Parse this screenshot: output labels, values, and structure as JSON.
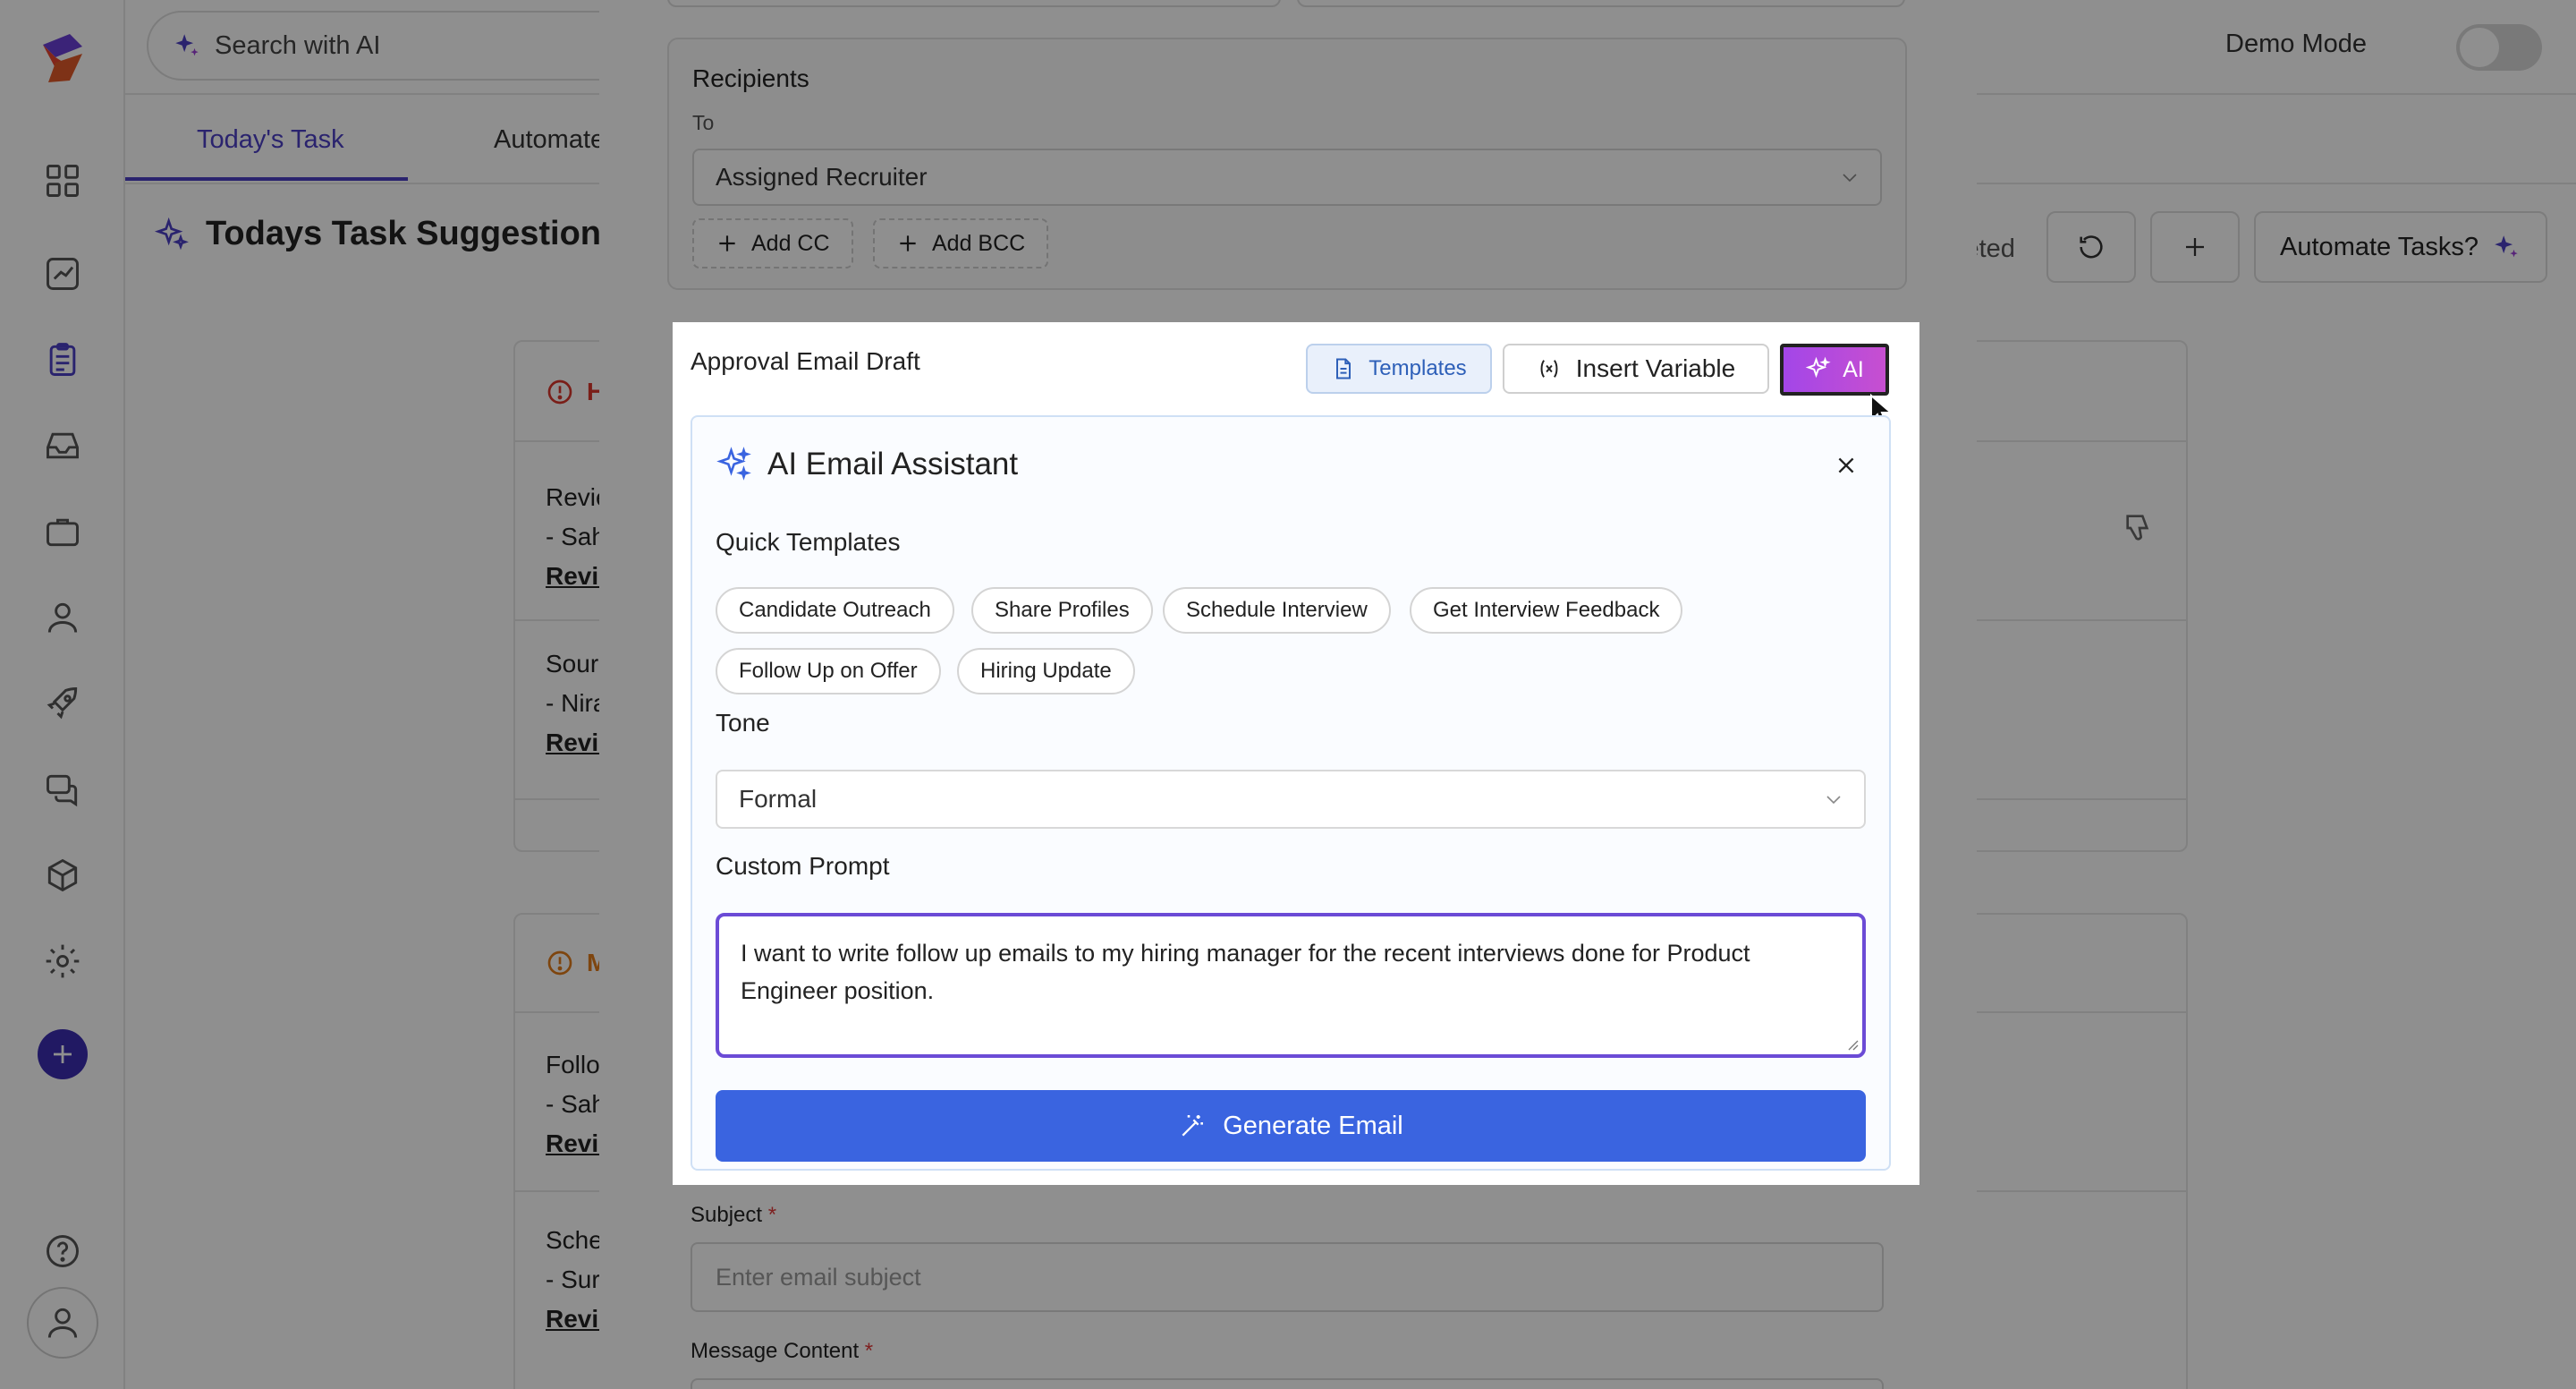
{
  "topbar": {
    "search_placeholder": "Search with AI",
    "demo_mode_label": "Demo Mode"
  },
  "tabs": [
    {
      "label": "Today's Task",
      "active": true
    },
    {
      "label": "Automate",
      "active": false
    }
  ],
  "page": {
    "title": "Todays Task Suggestions",
    "completed_label": "leted",
    "automate_button": "Automate Tasks?"
  },
  "cards": [
    {
      "badge": "H",
      "rows": [
        {
          "line1": "Revie",
          "line2": "- Sah",
          "link": "Revie"
        },
        {
          "line1": "Sourc",
          "line2": "- Nira",
          "link": "Revie"
        }
      ]
    },
    {
      "badge": "M",
      "rows": [
        {
          "line1": "Follo",
          "line2": "- Sah",
          "link": "Revie"
        },
        {
          "line1": "Sche",
          "line2": "- Sure",
          "link": "Revie"
        }
      ]
    }
  ],
  "modal": {
    "recipients": {
      "title": "Recipients",
      "to_label": "To",
      "to_value": "Assigned Recruiter",
      "add_cc": "Add CC",
      "add_bcc": "Add BCC"
    },
    "draft": {
      "title": "Approval Email Draft",
      "templates_button": "Templates",
      "insert_variable_button": "Insert Variable",
      "ai_button": "AI"
    },
    "assistant": {
      "title": "AI Email Assistant",
      "quick_templates_label": "Quick Templates",
      "quick_templates": [
        "Candidate Outreach",
        "Share Profiles",
        "Schedule Interview",
        "Get Interview Feedback",
        "Follow Up on Offer",
        "Hiring Update"
      ],
      "tone_label": "Tone",
      "tone_value": "Formal",
      "custom_prompt_label": "Custom Prompt",
      "custom_prompt_value": "I want to write follow up emails to my hiring manager for the recent interviews done for Product Engineer position.",
      "generate_button": "Generate Email"
    },
    "subject": {
      "label": "Subject",
      "required_mark": "*",
      "placeholder": "Enter email subject"
    },
    "message": {
      "label": "Message Content",
      "required_mark": "*"
    }
  },
  "colors": {
    "accent": "#4b3fc4",
    "ai_gradient_start": "#a346e8",
    "ai_gradient_end": "#c74fd0",
    "generate_button": "#3a64e0",
    "prompt_focus_border": "#6b4bd6",
    "high_priority": "#d9362b",
    "medium_priority": "#e07b1a"
  }
}
